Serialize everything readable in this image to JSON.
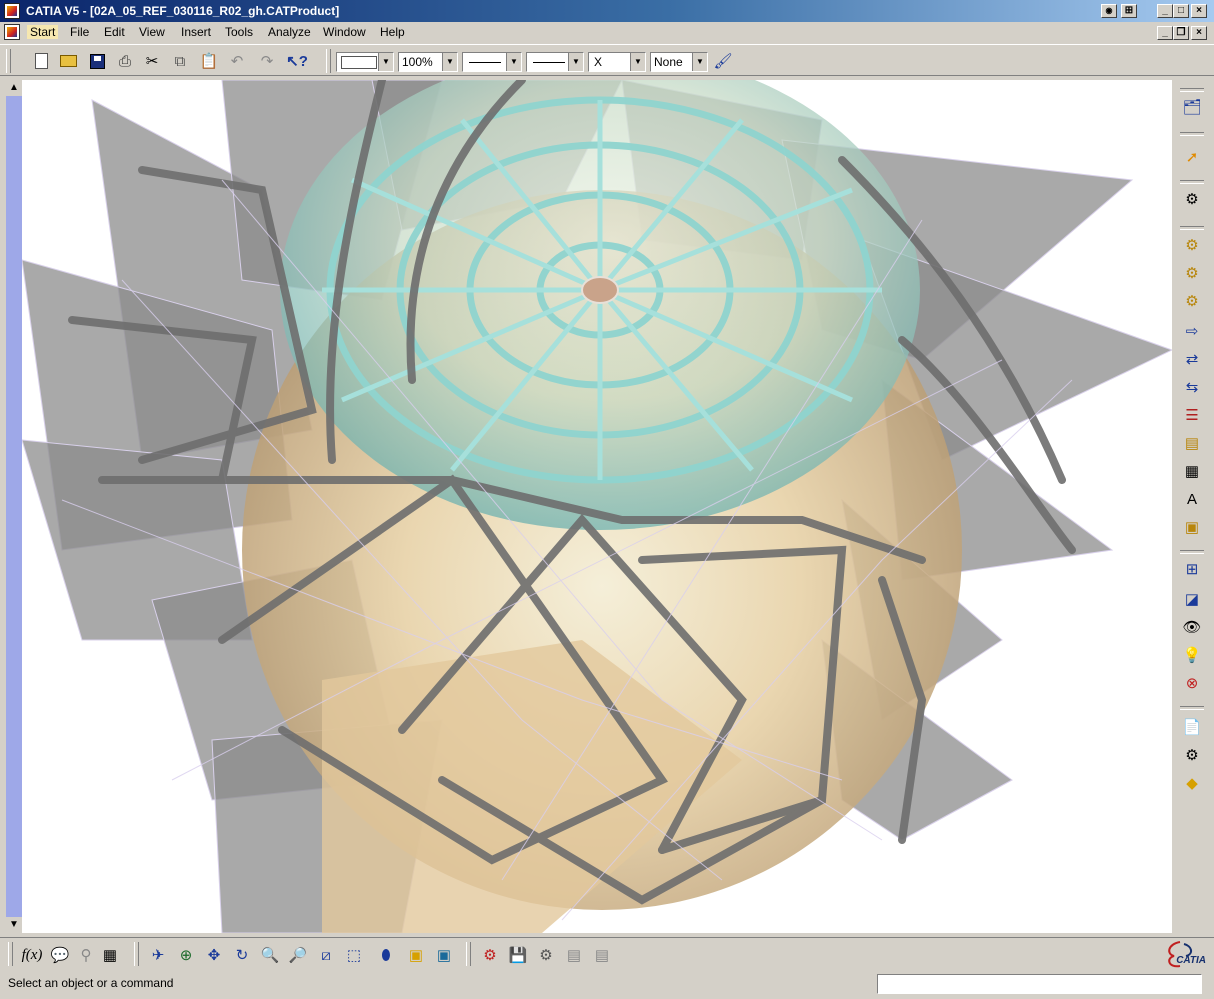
{
  "window": {
    "title": "CATIA V5 - [02A_05_REF_030116_R02_gh.CATProduct]",
    "controls": [
      "_",
      "□",
      "×"
    ],
    "mdi_controls": [
      "_",
      "❐",
      "×"
    ]
  },
  "menu": {
    "items": [
      "Start",
      "File",
      "Edit",
      "View",
      "Insert",
      "Tools",
      "Analyze",
      "Window",
      "Help"
    ],
    "active": "Start"
  },
  "toolbar": {
    "standard_icons": [
      "new-icon",
      "open-icon",
      "save-icon",
      "print-icon",
      "cut-icon",
      "copy-icon",
      "undo-icon",
      "redo-icon",
      "whats-this-icon"
    ],
    "color_value": "",
    "transparency_value": "100%",
    "linetype_value": "",
    "thickness_value": "",
    "point_style_value": "X",
    "layer_value": "None"
  },
  "right_toolbar": {
    "icons": [
      "product-structure-icon",
      "select-icon",
      "catalog-browser-icon",
      "component-icon",
      "new-product-icon",
      "new-part-icon",
      "existing-component-icon",
      "replace-component-icon",
      "graph-tree-icon",
      "generate-numbering-icon",
      "selective-load-icon",
      "manage-representations-icon",
      "multi-instantiation-icon",
      "fast-multi-instantiation-icon",
      "reorder-icon",
      "compass-snap-icon",
      "explode-icon",
      "stop-manipulate-icon",
      "hide-show-icon",
      "swap-visible-icon",
      "knowledge-icon",
      "formula-icon",
      "design-table-icon"
    ]
  },
  "bottom_toolbar": {
    "icons": [
      "formula-fx-icon",
      "comment-icon",
      "measure-icon",
      "table-icon",
      "fly-mode-icon",
      "fit-all-icon",
      "pan-icon",
      "rotate-icon",
      "zoom-in-icon",
      "zoom-out-icon",
      "normal-view-icon",
      "isometric-view-icon",
      "render-style-icon",
      "hide-icon",
      "swap-space-icon",
      "apply-material-icon",
      "sketcher-icon",
      "catalog-icon",
      "bom-icon",
      "properties-icon"
    ]
  },
  "status": {
    "message": "Select an object or a command",
    "command_input": ""
  },
  "brand": {
    "logo_text": "CATIA",
    "accent_color": "#0a246a",
    "scrollbar_color": "#9ea8e8"
  }
}
